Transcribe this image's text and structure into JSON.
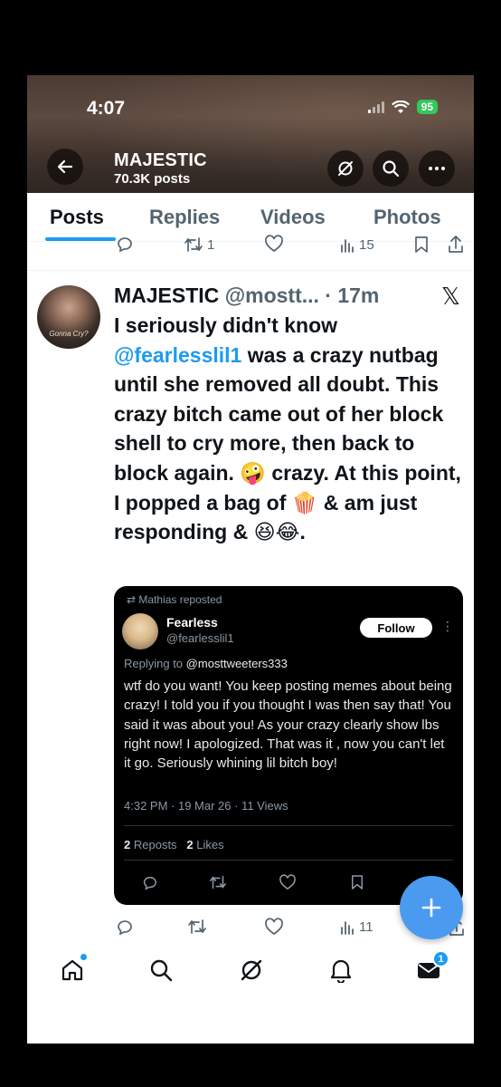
{
  "status": {
    "time": "4:07",
    "battery": "95"
  },
  "profile": {
    "name": "MAJESTIC",
    "post_count": "70.3K posts"
  },
  "tabs": [
    "Posts",
    "Replies",
    "Videos",
    "Photos"
  ],
  "prev_tweet": {
    "reposts": "1",
    "views": "15"
  },
  "tweet": {
    "author": "MAJESTIC",
    "handle": "@mostt...",
    "time": " · 17m",
    "text_before": "I seriously didn't know ",
    "mention": "@fearlesslil1",
    "text_after": " was a crazy nutbag until she removed all doubt. This crazy bitch came out of her block shell to cry more, then back to block again. 🤪 crazy. At this point, I popped a bag of 🍿 & am just responding & 😆😂.",
    "avatar_caption": "Gonna Cry?",
    "views": "11"
  },
  "embedded": {
    "reposted_by": "Mathias reposted",
    "name": "Fearless",
    "handle": "@fearlesslil1",
    "follow_label": "Follow",
    "replying_label": "Replying to",
    "replying_to": "@mosttweeters333",
    "text": "wtf do you want! You keep posting memes about being crazy! I told you if you thought I was then say that! You said it was about you! As your crazy clearly show lbs right now! I apologized. That was it , now you can't let it go. Seriously whining lil bitch boy!",
    "meta": "4:32 PM · 19 Mar 26 · 11 Views",
    "reposts_count": "2",
    "reposts_label": "Reposts",
    "likes_count": "2",
    "likes_label": "Likes"
  },
  "nav": {
    "messages_badge": "1"
  },
  "icons": [
    "back-arrow-icon",
    "grok-icon",
    "search-icon",
    "more-icon",
    "x-logo-icon",
    "reply-icon",
    "repost-icon",
    "like-icon",
    "views-icon",
    "bookmark-icon",
    "share-icon",
    "home-icon",
    "notifications-icon",
    "messages-icon",
    "plus-icon"
  ],
  "colors": {
    "accent": "#1d9bf0",
    "fab": "#4a9bf0",
    "text": "#0f1419",
    "muted": "#536471"
  }
}
